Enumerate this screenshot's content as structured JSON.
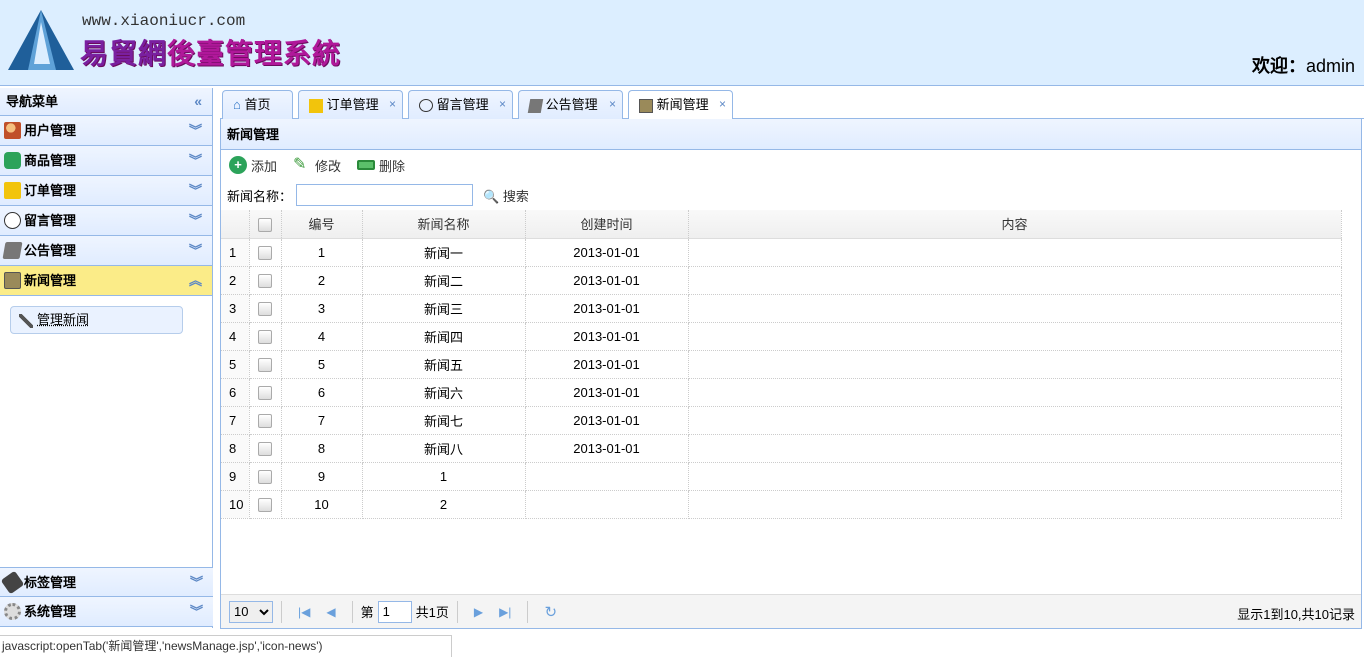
{
  "header": {
    "site_url": "www.xiaoniucr.com",
    "site_title_a": "易貿網",
    "site_title_b": "後臺管理系統",
    "welcome_label": "欢迎：",
    "username": "admin"
  },
  "nav": {
    "title": "导航菜单",
    "items": [
      {
        "label": "用户管理",
        "icon": "users-icon"
      },
      {
        "label": "商品管理",
        "icon": "goods-icon"
      },
      {
        "label": "订单管理",
        "icon": "order-icon"
      },
      {
        "label": "留言管理",
        "icon": "message-icon"
      },
      {
        "label": "公告管理",
        "icon": "notice-icon"
      },
      {
        "label": "新闻管理",
        "icon": "news-icon"
      }
    ],
    "sub_item": "管理新闻",
    "bottom_items": [
      {
        "label": "标签管理"
      },
      {
        "label": "系统管理"
      }
    ]
  },
  "tabs": [
    {
      "label": "首页",
      "closable": false
    },
    {
      "label": "订单管理",
      "closable": true
    },
    {
      "label": "留言管理",
      "closable": true
    },
    {
      "label": "公告管理",
      "closable": true
    },
    {
      "label": "新闻管理",
      "closable": true,
      "active": true
    }
  ],
  "panel": {
    "title": "新闻管理",
    "toolbar": {
      "add": "添加",
      "edit": "修改",
      "delete": "删除"
    },
    "search": {
      "label": "新闻名称：",
      "value": "",
      "button": "搜索"
    },
    "columns": [
      "编号",
      "新闻名称",
      "创建时间",
      "内容"
    ],
    "rows": [
      {
        "n": "1",
        "id": "1",
        "name": "新闻一",
        "time": "2013-01-01",
        "content": ""
      },
      {
        "n": "2",
        "id": "2",
        "name": "新闻二",
        "time": "2013-01-01",
        "content": ""
      },
      {
        "n": "3",
        "id": "3",
        "name": "新闻三",
        "time": "2013-01-01",
        "content": ""
      },
      {
        "n": "4",
        "id": "4",
        "name": "新闻四",
        "time": "2013-01-01",
        "content": ""
      },
      {
        "n": "5",
        "id": "5",
        "name": "新闻五",
        "time": "2013-01-01",
        "content": ""
      },
      {
        "n": "6",
        "id": "6",
        "name": "新闻六",
        "time": "2013-01-01",
        "content": ""
      },
      {
        "n": "7",
        "id": "7",
        "name": "新闻七",
        "time": "2013-01-01",
        "content": ""
      },
      {
        "n": "8",
        "id": "8",
        "name": "新闻八",
        "time": "2013-01-01",
        "content": ""
      },
      {
        "n": "9",
        "id": "9",
        "name": "1",
        "time": "",
        "content": ""
      },
      {
        "n": "10",
        "id": "10",
        "name": "2",
        "time": "",
        "content": ""
      }
    ],
    "pager": {
      "page_size": "10",
      "page_prefix": "第",
      "page": "1",
      "page_suffix": "共1页",
      "info": "显示1到10,共10记录"
    }
  },
  "status_bar": "javascript:openTab('新闻管理','newsManage.jsp','icon-news')"
}
